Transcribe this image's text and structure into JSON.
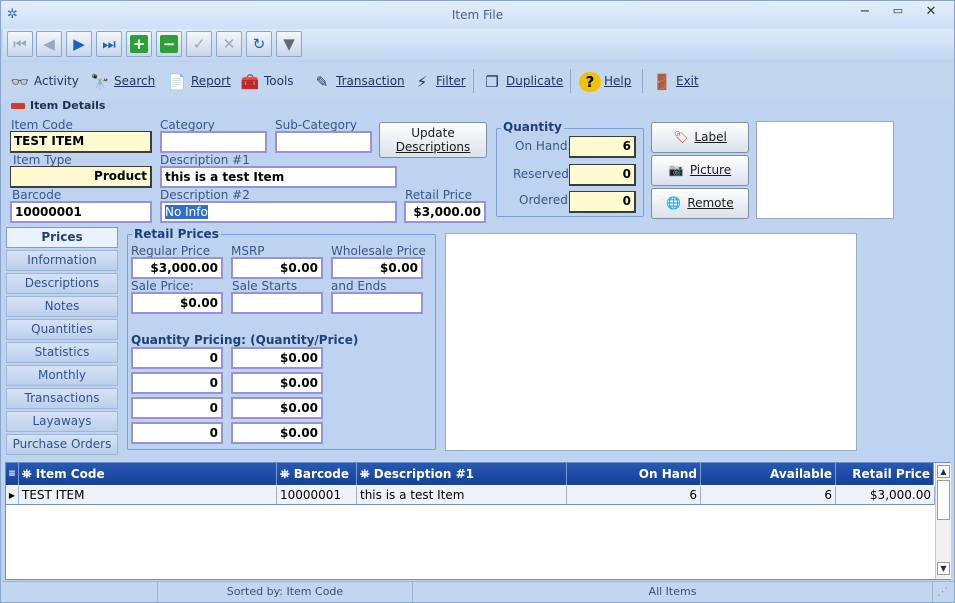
{
  "window": {
    "title": "Item File",
    "min": "−",
    "max": "▭",
    "close": "✕"
  },
  "nav": {
    "first": "⏮",
    "prev": "◀",
    "next": "▶",
    "last": "⏭",
    "add": "+",
    "delete": "−",
    "post": "✓",
    "cancel": "✕",
    "refresh": "↻",
    "filter": "▼"
  },
  "toolbar": {
    "activity": "Activity",
    "search": "Search",
    "report": "Report",
    "tools": "Tools",
    "transaction": "Transaction",
    "filter": "Filter",
    "duplicate": "Duplicate",
    "help": "Help",
    "exit": "Exit"
  },
  "section_title": "Item Details",
  "fields": {
    "item_code_label": "Item Code",
    "item_code": "TEST ITEM",
    "category_label": "Category",
    "category": "",
    "subcategory_label": "Sub-Category",
    "subcategory": "",
    "item_type_label": "Item Type",
    "item_type": "Product",
    "desc1_label": "Description #1",
    "desc1": "this is a test Item",
    "barcode_label": "Barcode",
    "barcode": "10000001",
    "desc2_label": "Description #2",
    "desc2": "No Info",
    "retail_label": "Retail Price",
    "retail": "$3,000.00"
  },
  "update_desc_btn": {
    "line1": "Update",
    "line2": "Descriptions"
  },
  "quantity": {
    "title": "Quantity",
    "on_hand_label": "On Hand:",
    "on_hand": "6",
    "reserved_label": "Reserved:",
    "reserved": "0",
    "ordered_label": "Ordered:",
    "ordered": "0"
  },
  "side_buttons": {
    "label": "Label",
    "picture": "Picture",
    "remote": "Remote"
  },
  "tabs": [
    "Prices",
    "Information",
    "Descriptions",
    "Notes",
    "Quantities",
    "Statistics",
    "Monthly Quantities",
    "Transactions",
    "Layaways",
    "Purchase Orders"
  ],
  "retail_prices": {
    "title": "Retail Prices",
    "regular_label": "Regular Price",
    "regular": "$3,000.00",
    "msrp_label": "MSRP",
    "msrp": "$0.00",
    "wholesale_label": "Wholesale Price",
    "wholesale": "$0.00",
    "sale_label": "Sale Price:",
    "sale": "$0.00",
    "sale_starts_label": "Sale Starts",
    "sale_starts": "",
    "sale_ends_label": "and Ends",
    "sale_ends": "",
    "qty_pricing_title": "Quantity Pricing: (Quantity/Price)",
    "qty_rows": [
      {
        "qty": "0",
        "price": "$0.00"
      },
      {
        "qty": "0",
        "price": "$0.00"
      },
      {
        "qty": "0",
        "price": "$0.00"
      },
      {
        "qty": "0",
        "price": "$0.00"
      }
    ]
  },
  "grid": {
    "headers": {
      "item_code": "Item Code",
      "barcode": "Barcode",
      "desc1": "Description #1",
      "on_hand": "On Hand",
      "available": "Available",
      "retail_price": "Retail Price"
    },
    "rows": [
      {
        "item_code": "TEST ITEM",
        "barcode": "10000001",
        "desc1": "this is a test Item",
        "on_hand": "6",
        "available": "6",
        "retail_price": "$3,000.00"
      }
    ]
  },
  "status": {
    "sorted": "Sorted by: Item Code",
    "filter": "All Items"
  }
}
